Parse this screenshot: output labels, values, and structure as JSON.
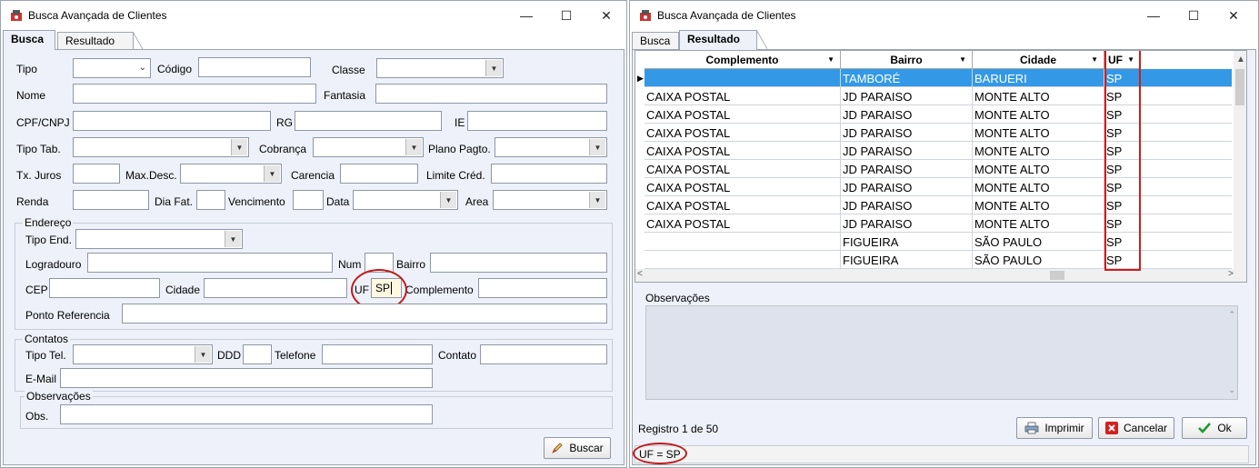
{
  "left_window": {
    "title": "Busca Avançada de Clientes",
    "tabs": [
      "Busca",
      "Resultado"
    ],
    "labels": {
      "tipo": "Tipo",
      "codigo": "Código",
      "classe": "Classe",
      "nome": "Nome",
      "fantasia": "Fantasia",
      "cpf": "CPF/CNPJ",
      "rg": "RG",
      "ie": "IE",
      "tipo_tab": "Tipo Tab.",
      "cobranca": "Cobrança",
      "plano": "Plano Pagto.",
      "tx_juros": "Tx. Juros",
      "max_desc": "Max.Desc.",
      "carencia": "Carencia",
      "limite": "Limite Créd.",
      "renda": "Renda",
      "dia_fat": "Dia Fat.",
      "vencimento": "Vencimento",
      "data": "Data",
      "area": "Area",
      "tipo_end": "Tipo End.",
      "logradouro": "Logradouro",
      "num": "Num",
      "bairro": "Bairro",
      "cep": "CEP",
      "cidade": "Cidade",
      "uf": "UF",
      "complemento": "Complemento",
      "ponto_ref": "Ponto Referencia",
      "tipo_tel": "Tipo Tel.",
      "ddd": "DDD",
      "telefone": "Telefone",
      "contato": "Contato",
      "email": "E-Mail",
      "obs": "Obs."
    },
    "groups": {
      "endereco": "Endereço",
      "contatos": "Contatos",
      "observacoes": "Observações"
    },
    "uf_value": "SP",
    "search_button": "Buscar"
  },
  "right_window": {
    "title": "Busca Avançada de Clientes",
    "tabs": [
      "Busca",
      "Resultado"
    ],
    "columns": [
      "Complemento",
      "Bairro",
      "Cidade",
      "UF"
    ],
    "rows": [
      [
        "",
        "TAMBORÉ",
        "BARUERI",
        "SP"
      ],
      [
        "CAIXA POSTAL",
        "JD PARAISO",
        "MONTE ALTO",
        "SP"
      ],
      [
        "CAIXA POSTAL",
        "JD PARAISO",
        "MONTE ALTO",
        "SP"
      ],
      [
        "CAIXA POSTAL",
        "JD PARAISO",
        "MONTE ALTO",
        "SP"
      ],
      [
        "CAIXA POSTAL",
        "JD PARAISO",
        "MONTE ALTO",
        "SP"
      ],
      [
        "CAIXA POSTAL",
        "JD PARAISO",
        "MONTE ALTO",
        "SP"
      ],
      [
        "CAIXA POSTAL",
        "JD PARAISO",
        "MONTE ALTO",
        "SP"
      ],
      [
        "CAIXA POSTAL",
        "JD PARAISO",
        "MONTE ALTO",
        "SP"
      ],
      [
        "CAIXA POSTAL",
        "JD PARAISO",
        "MONTE ALTO",
        "SP"
      ],
      [
        "",
        "FIGUEIRA",
        "SÃO PAULO",
        "SP"
      ],
      [
        "",
        "FIGUEIRA",
        "SÃO PAULO",
        "SP"
      ]
    ],
    "observacoes_label": "Observações",
    "registro": "Registro 1 de 50",
    "buttons": {
      "imprimir": "Imprimir",
      "cancelar": "Cancelar",
      "ok": "Ok"
    },
    "filter_status": "UF = SP"
  },
  "colors": {
    "selection": "#3399e6",
    "highlight": "#d01c1c",
    "panel": "#eef1fa"
  }
}
